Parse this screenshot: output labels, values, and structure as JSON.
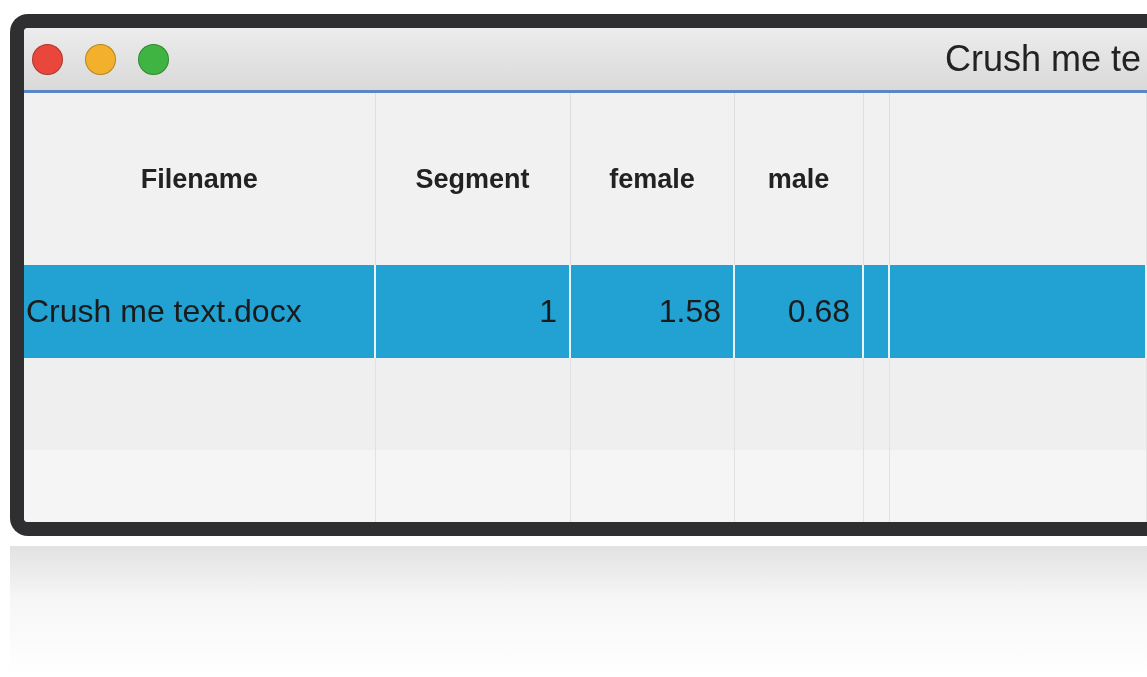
{
  "window": {
    "title": "Crush me te"
  },
  "table": {
    "columns": [
      {
        "label": "Filename"
      },
      {
        "label": "Segment"
      },
      {
        "label": "female"
      },
      {
        "label": "male"
      }
    ],
    "rows": [
      {
        "selected": true,
        "cells": [
          "Crush me text.docx",
          "1",
          "1.58",
          "0.68"
        ]
      }
    ]
  }
}
